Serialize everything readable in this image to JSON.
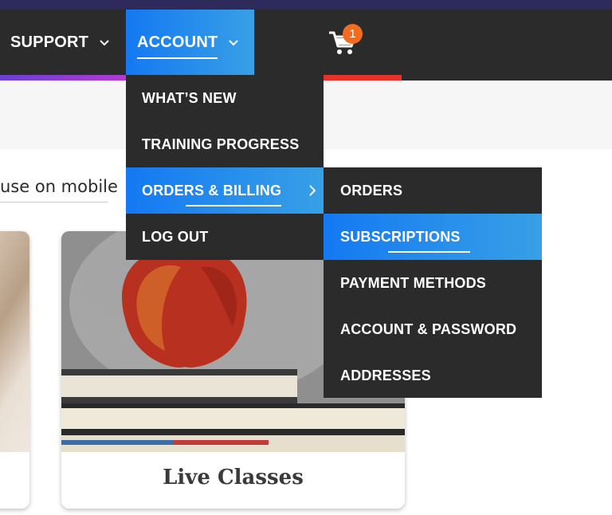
{
  "nav": {
    "support_label": "SUPPORT",
    "account_label": "ACCOUNT",
    "cart_count": "1"
  },
  "account_menu": {
    "items": [
      {
        "label": "WHAT’S NEW"
      },
      {
        "label": "TRAINING PROGRESS"
      },
      {
        "label": "ORDERS & BILLING"
      },
      {
        "label": "LOG OUT"
      }
    ]
  },
  "billing_submenu": {
    "items": [
      {
        "label": "ORDERS"
      },
      {
        "label": "SUBSCRIPTIONS"
      },
      {
        "label": "PAYMENT METHODS"
      },
      {
        "label": "ACCOUNT & PASSWORD"
      },
      {
        "label": "ADDRESSES"
      }
    ]
  },
  "content": {
    "mobile_text": "use on mobile",
    "card_title": "Live Classes"
  },
  "colors": {
    "nav_bg": "#2b2b2b",
    "accent_blue": "#1479f2",
    "badge_orange": "#f26b21"
  }
}
